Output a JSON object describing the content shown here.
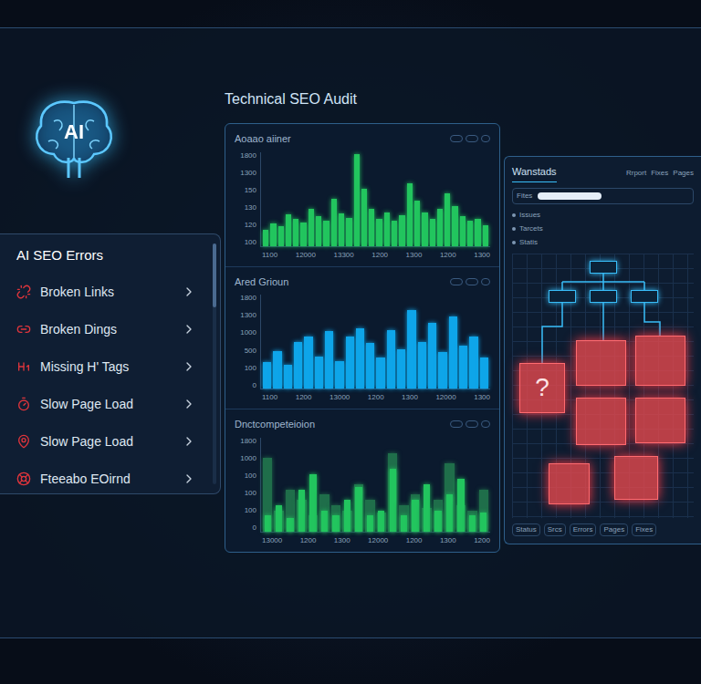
{
  "title": "Technical SEO Audit",
  "brand": {
    "label": "AI"
  },
  "errors_panel": {
    "title": "AI SEO Errors",
    "items": [
      {
        "label": "Broken Links"
      },
      {
        "label": "Broken Dings"
      },
      {
        "label": "Missing H' Tags"
      },
      {
        "label": "Slow Page Load"
      },
      {
        "label": "Slow Page Load"
      },
      {
        "label": "Fteeabo EOirnd"
      }
    ]
  },
  "charts": [
    {
      "title": "Aoaao aiiner",
      "y_ticks": [
        "1800",
        "1300",
        "150",
        "130",
        "120",
        "100"
      ],
      "x_ticks": [
        "1100",
        "12000",
        "13300",
        "1200",
        "1300",
        "1200",
        "1300"
      ],
      "series": [
        {
          "color": "#22c55e",
          "values": [
            300,
            420,
            380,
            600,
            520,
            450,
            700,
            560,
            480,
            900,
            620,
            540,
            1750,
            1100,
            700,
            520,
            640,
            480,
            580,
            1200,
            860,
            640,
            520,
            700,
            1000,
            760,
            560,
            480,
            520,
            400
          ]
        }
      ]
    },
    {
      "title": "Ared Grioun",
      "y_ticks": [
        "1800",
        "1300",
        "1000",
        "500",
        "100",
        "0"
      ],
      "x_ticks": [
        "1100",
        "1200",
        "13000",
        "1200",
        "1300",
        "12000",
        "1300"
      ],
      "series": [
        {
          "color": "#0ea5e9",
          "values": [
            500,
            720,
            460,
            900,
            1000,
            620,
            1100,
            520,
            1000,
            1150,
            880,
            600,
            1120,
            760,
            1500,
            900,
            1250,
            700,
            1380,
            820,
            1000,
            600
          ]
        }
      ]
    },
    {
      "title": "Dnctcompeteioion",
      "y_ticks": [
        "1800",
        "1000",
        "100",
        "100",
        "100",
        "0"
      ],
      "x_ticks": [
        "13000",
        "1200",
        "1300",
        "12000",
        "1200",
        "1300",
        "1200"
      ],
      "series": [
        {
          "color": "#1f6e4a",
          "values": [
            1400,
            400,
            800,
            600,
            300,
            700,
            500,
            400,
            900,
            600,
            350,
            1500,
            500,
            700,
            450,
            600,
            1300,
            500,
            400,
            800
          ]
        },
        {
          "color": "#22c55e",
          "values": [
            300,
            500,
            250,
            800,
            1100,
            400,
            300,
            600,
            850,
            300,
            400,
            1200,
            300,
            600,
            900,
            400,
            700,
            1000,
            300,
            350
          ]
        }
      ]
    }
  ],
  "side_panel": {
    "title": "Wanstads",
    "tabs": [
      "Rrport",
      "Fixes",
      "Pages"
    ],
    "field": {
      "label": "Fites"
    },
    "list": [
      "Issues",
      "Tarcets",
      "Statis"
    ],
    "diagram": {
      "blocks": [
        {
          "label": "?"
        },
        {
          "label": ""
        },
        {
          "label": ""
        },
        {
          "label": ""
        },
        {
          "label": ""
        },
        {
          "label": ""
        },
        {
          "label": ""
        }
      ]
    },
    "footer_tabs": [
      "Status",
      "Srcs",
      "Errors",
      "Pages",
      "Fixes"
    ]
  }
}
